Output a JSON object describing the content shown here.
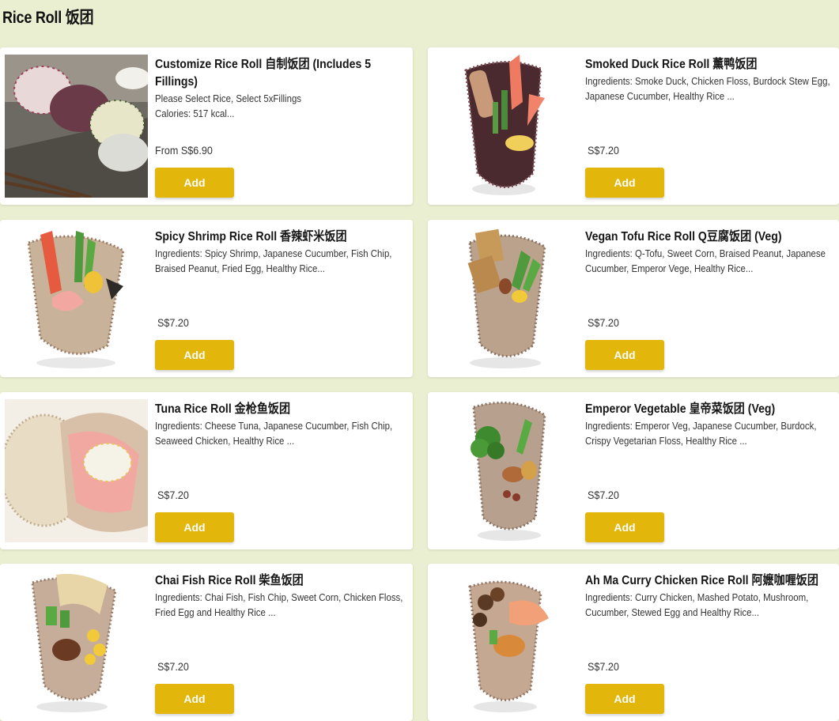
{
  "section": {
    "title": "Rice Roll 饭团"
  },
  "button_label": "Add",
  "accent_color": "#e2b60b",
  "items": [
    {
      "name": "Customize Rice Roll 自制饭团 (Includes 5 Fillings)",
      "desc1": "Please Select Rice, Select 5xFillings",
      "desc2": "Calories: 517 kcal...",
      "price": "From S$6.90",
      "image": "rice-balls-platter-image"
    },
    {
      "name": "Smoked Duck Rice Roll 薰鸭饭团",
      "desc1": "Ingredients:  Smoke Duck, Chicken Floss, Burdock Stew Egg, Japanese Cucumber, Healthy Rice ...",
      "desc2": "",
      "price": "S$7.20",
      "image": "smoked-duck-rice-roll-image"
    },
    {
      "name": "Spicy Shrimp Rice Roll 香辣虾米饭团",
      "desc1": "Ingredients:  Spicy Shrimp, Japanese Cucumber, Fish Chip, Braised Peanut, Fried Egg, Healthy Rice...",
      "desc2": "",
      "price": "S$7.20",
      "image": "spicy-shrimp-rice-roll-image"
    },
    {
      "name": "Vegan Tofu Rice Roll Q豆腐饭团 (Veg)",
      "desc1": "Ingredients:  Q-Tofu, Sweet Corn, Braised Peanut, Japanese Cucumber, Emperor Vege, Healthy Rice...",
      "desc2": "",
      "price": "S$7.20",
      "image": "vegan-tofu-rice-roll-image"
    },
    {
      "name": "Tuna Rice Roll 金枪鱼饭团",
      "desc1": "Ingredients:  Cheese Tuna, Japanese Cucumber, Fish Chip, Seaweed Chicken, Healthy Rice ...",
      "desc2": "",
      "price": "S$7.20",
      "image": "tuna-rice-roll-image"
    },
    {
      "name": "Emperor Vegetable 皇帝菜饭团 (Veg)",
      "desc1": "Ingredients:  Emperor Veg, Japanese Cucumber, Burdock, Crispy Vegetarian Floss, Healthy Rice ...",
      "desc2": "",
      "price": "S$7.20",
      "image": "emperor-vegetable-rice-roll-image"
    },
    {
      "name": "Chai Fish Rice Roll 柴鱼饭团",
      "desc1": "Ingredients:  Chai Fish, Fish Chip, Sweet Corn, Chicken Floss, Fried Egg and Healthy Rice ...",
      "desc2": "",
      "price": "S$7.20",
      "image": "chai-fish-rice-roll-image"
    },
    {
      "name": "Ah Ma Curry Chicken Rice Roll 阿嬷咖喱饭团",
      "desc1": "Ingredients: Curry Chicken, Mashed Potato, Mushroom, Cucumber, Stewed Egg and Healthy Rice...",
      "desc2": "",
      "price": "S$7.20",
      "image": "curry-chicken-rice-roll-image"
    }
  ]
}
